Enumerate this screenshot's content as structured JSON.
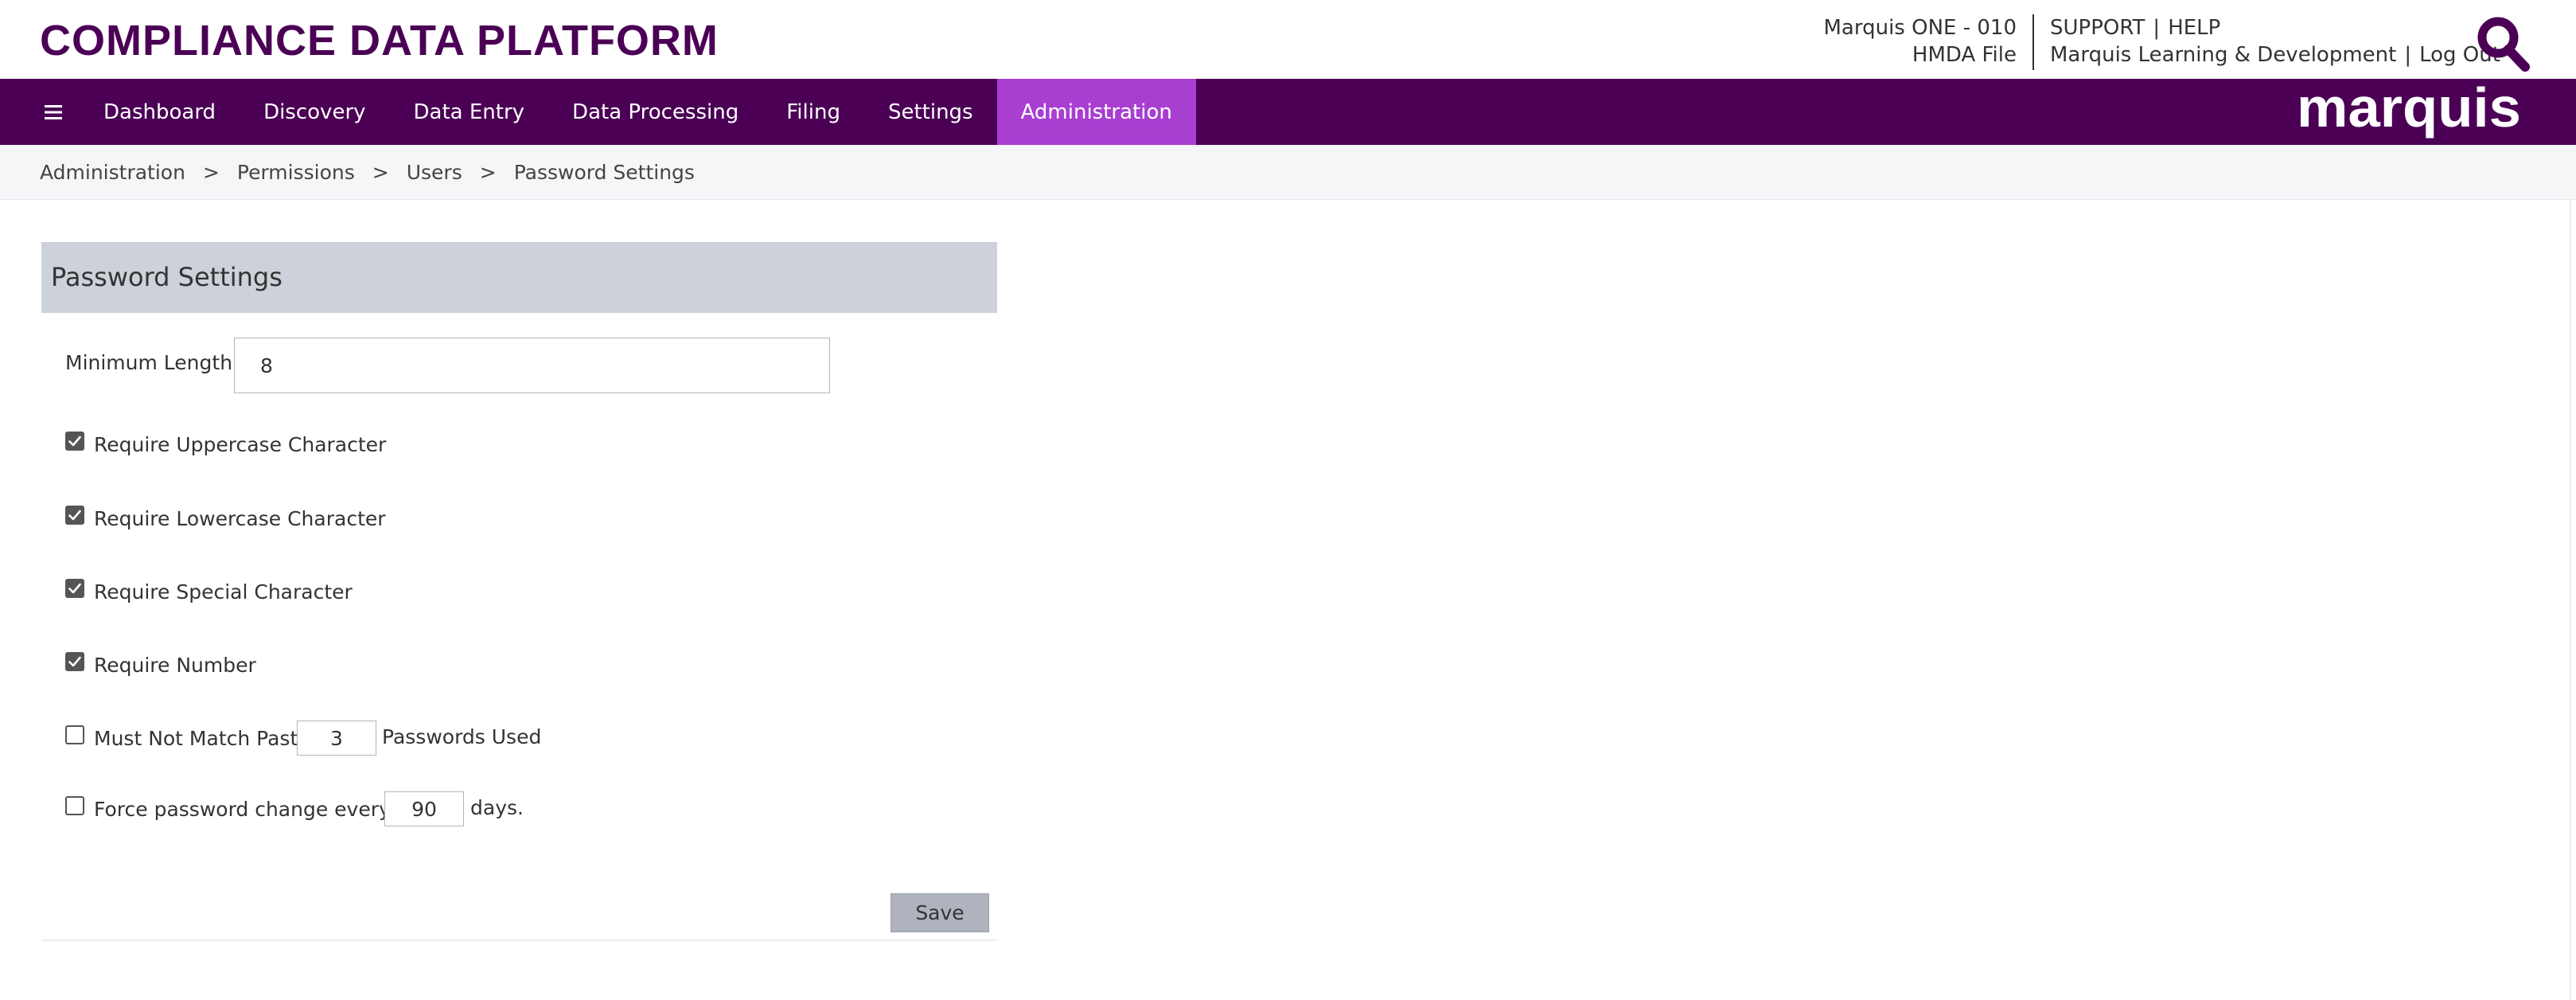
{
  "colors": {
    "brand_purple": "#4b0055",
    "active_nav": "#a83fd1",
    "nav_text": "#ffffff",
    "panel_header_bg": "#cdd1da",
    "save_button_bg": "#aeb3bd",
    "checkbox_fill": "#555555"
  },
  "header": {
    "app_title": "COMPLIANCE DATA PLATFORM",
    "org_name": "Marquis ONE - 010",
    "org_file": "HMDA File",
    "support_label": "SUPPORT",
    "help_label": "HELP",
    "user_name": "Marquis Learning & Development",
    "logout_label": "Log Out",
    "link_separator": "|",
    "search_icon": "magnifier-icon"
  },
  "nav": {
    "menu_icon": "hamburger-menu-icon",
    "items": [
      {
        "label": "Dashboard"
      },
      {
        "label": "Discovery"
      },
      {
        "label": "Data Entry"
      },
      {
        "label": "Data Processing"
      },
      {
        "label": "Filing"
      },
      {
        "label": "Settings"
      },
      {
        "label": "Administration",
        "active": true
      }
    ],
    "brand": "marquis"
  },
  "breadcrumb": {
    "items": [
      "Administration",
      "Permissions",
      "Users",
      "Password Settings"
    ],
    "separator": ">"
  },
  "panel": {
    "title": "Password Settings",
    "min_length_label": "Minimum Length",
    "min_length_value": "8",
    "require_uppercase": {
      "label": "Require Uppercase Character",
      "checked": true
    },
    "require_lowercase": {
      "label": "Require Lowercase Character",
      "checked": true
    },
    "require_special": {
      "label": "Require Special Character",
      "checked": true
    },
    "require_number": {
      "label": "Require Number",
      "checked": true
    },
    "past_passwords": {
      "label_before": "Must Not Match Past",
      "value": "3",
      "label_after": "Passwords Used",
      "checked": false
    },
    "force_change": {
      "label_before": "Force password change every",
      "value": "90",
      "label_after": "days.",
      "checked": false
    },
    "save_label": "Save"
  }
}
